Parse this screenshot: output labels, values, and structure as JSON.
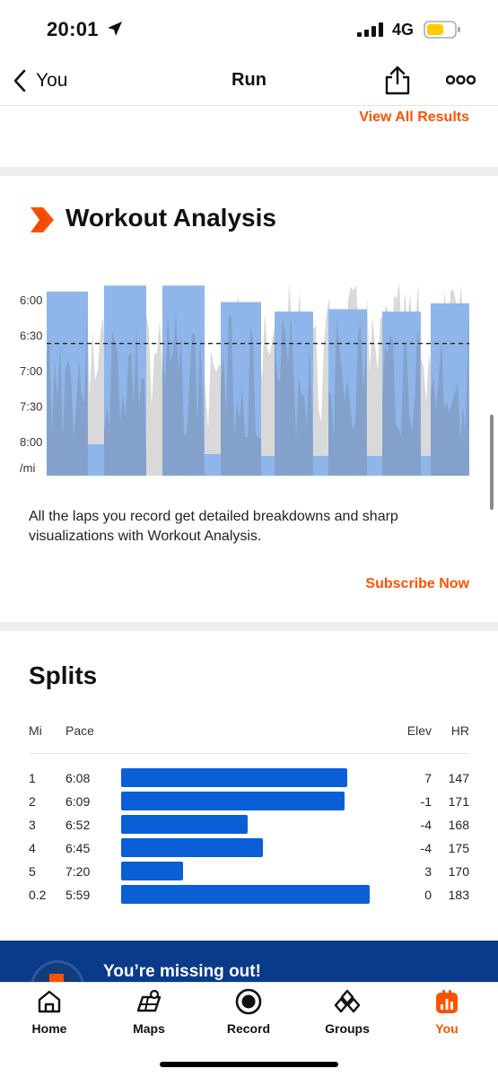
{
  "status": {
    "time": "20:01",
    "network": "4G",
    "location_icon": "location-arrow-icon",
    "signal_icon": "signal-bars-icon",
    "battery_icon": "battery-icon"
  },
  "nav": {
    "back_label": "You",
    "title": "Run",
    "share_icon": "share-icon",
    "more_icon": "more-icon"
  },
  "results": {
    "view_all_label": "View All Results"
  },
  "workout_analysis": {
    "title": "Workout Analysis",
    "icon": "chevron-badge-icon",
    "description": "All the laps you record get detailed breakdowns and sharp visualizations with Workout Analysis.",
    "cta": "Subscribe Now"
  },
  "chart_data": {
    "type": "bar",
    "ylabels": [
      "6:00",
      "6:30",
      "7:00",
      "7:30",
      "8:00",
      "/mi"
    ],
    "y_axis": "pace (min/mi), faster at top",
    "reference_line_pace": "6:37",
    "laps": [
      {
        "pace": "5:53"
      },
      {
        "pace": "5:48"
      },
      {
        "pace": "5:48"
      },
      {
        "pace": "6:02"
      },
      {
        "pace": "6:10"
      },
      {
        "pace": "6:08"
      },
      {
        "pace": "6:10"
      },
      {
        "pace": "6:03"
      }
    ],
    "colors": {
      "lap_bar": "#8fb6ea",
      "pace_trace": "#d9d9d9",
      "dark_area": "#7b90b0"
    }
  },
  "splits": {
    "title": "Splits",
    "headers": {
      "mi": "Mi",
      "pace": "Pace",
      "elev": "Elev",
      "hr": "HR"
    },
    "rows": [
      {
        "mi": "1",
        "pace": "6:08",
        "elev": "7",
        "hr": "147",
        "speed_fraction": 0.91
      },
      {
        "mi": "2",
        "pace": "6:09",
        "elev": "-1",
        "hr": "171",
        "speed_fraction": 0.9
      },
      {
        "mi": "3",
        "pace": "6:52",
        "elev": "-4",
        "hr": "168",
        "speed_fraction": 0.51
      },
      {
        "mi": "4",
        "pace": "6:45",
        "elev": "-4",
        "hr": "175",
        "speed_fraction": 0.57
      },
      {
        "mi": "5",
        "pace": "7:20",
        "elev": "3",
        "hr": "170",
        "speed_fraction": 0.25
      },
      {
        "mi": "0.2",
        "pace": "5:59",
        "elev": "0",
        "hr": "183",
        "speed_fraction": 1.0
      }
    ],
    "bar_color": "#0b5fd6"
  },
  "promo": {
    "text": "You’re missing out!"
  },
  "tabs": [
    {
      "label": "Home",
      "icon": "home-icon",
      "active": false
    },
    {
      "label": "Maps",
      "icon": "map-icon",
      "active": false
    },
    {
      "label": "Record",
      "icon": "record-icon",
      "active": false
    },
    {
      "label": "Groups",
      "icon": "groups-icon",
      "active": false
    },
    {
      "label": "You",
      "icon": "you-icon",
      "active": true
    }
  ],
  "accent": "#fc5200"
}
